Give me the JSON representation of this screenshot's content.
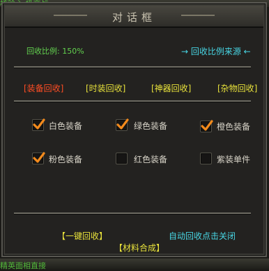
{
  "top_overlay_text": "核验心  极交战",
  "dialog": {
    "title": "对话框",
    "ratio_label": "回收比例: 150%",
    "source_link": "→ 回收比例来源 ←",
    "tabs": [
      {
        "label": "[装备回收]",
        "active": true
      },
      {
        "label": "[时装回收]",
        "active": false
      },
      {
        "label": "[神器回收]",
        "active": false
      },
      {
        "label": "[杂物回收]",
        "active": false
      }
    ],
    "checkboxes": [
      {
        "label": "白色装备",
        "checked": true
      },
      {
        "label": "绿色装备",
        "checked": true
      },
      {
        "label": "橙色装备",
        "checked": true
      },
      {
        "label": "粉色装备",
        "checked": true
      },
      {
        "label": "红色装备",
        "checked": false
      },
      {
        "label": "紫装单件",
        "checked": false
      }
    ],
    "one_key_recycle": "【一键回收】",
    "auto_recycle": "自动回收点击关闭",
    "material_synthesis": "【材料合成】"
  },
  "bottom_overlay_text": "精英面相直接",
  "colors": {
    "accent_green": "#63d24f",
    "link_cyan": "#48d6e4",
    "tab_yellow": "#e8e23b",
    "tab_active_red": "#ff4d24",
    "check_orange": "#f28a1c"
  }
}
